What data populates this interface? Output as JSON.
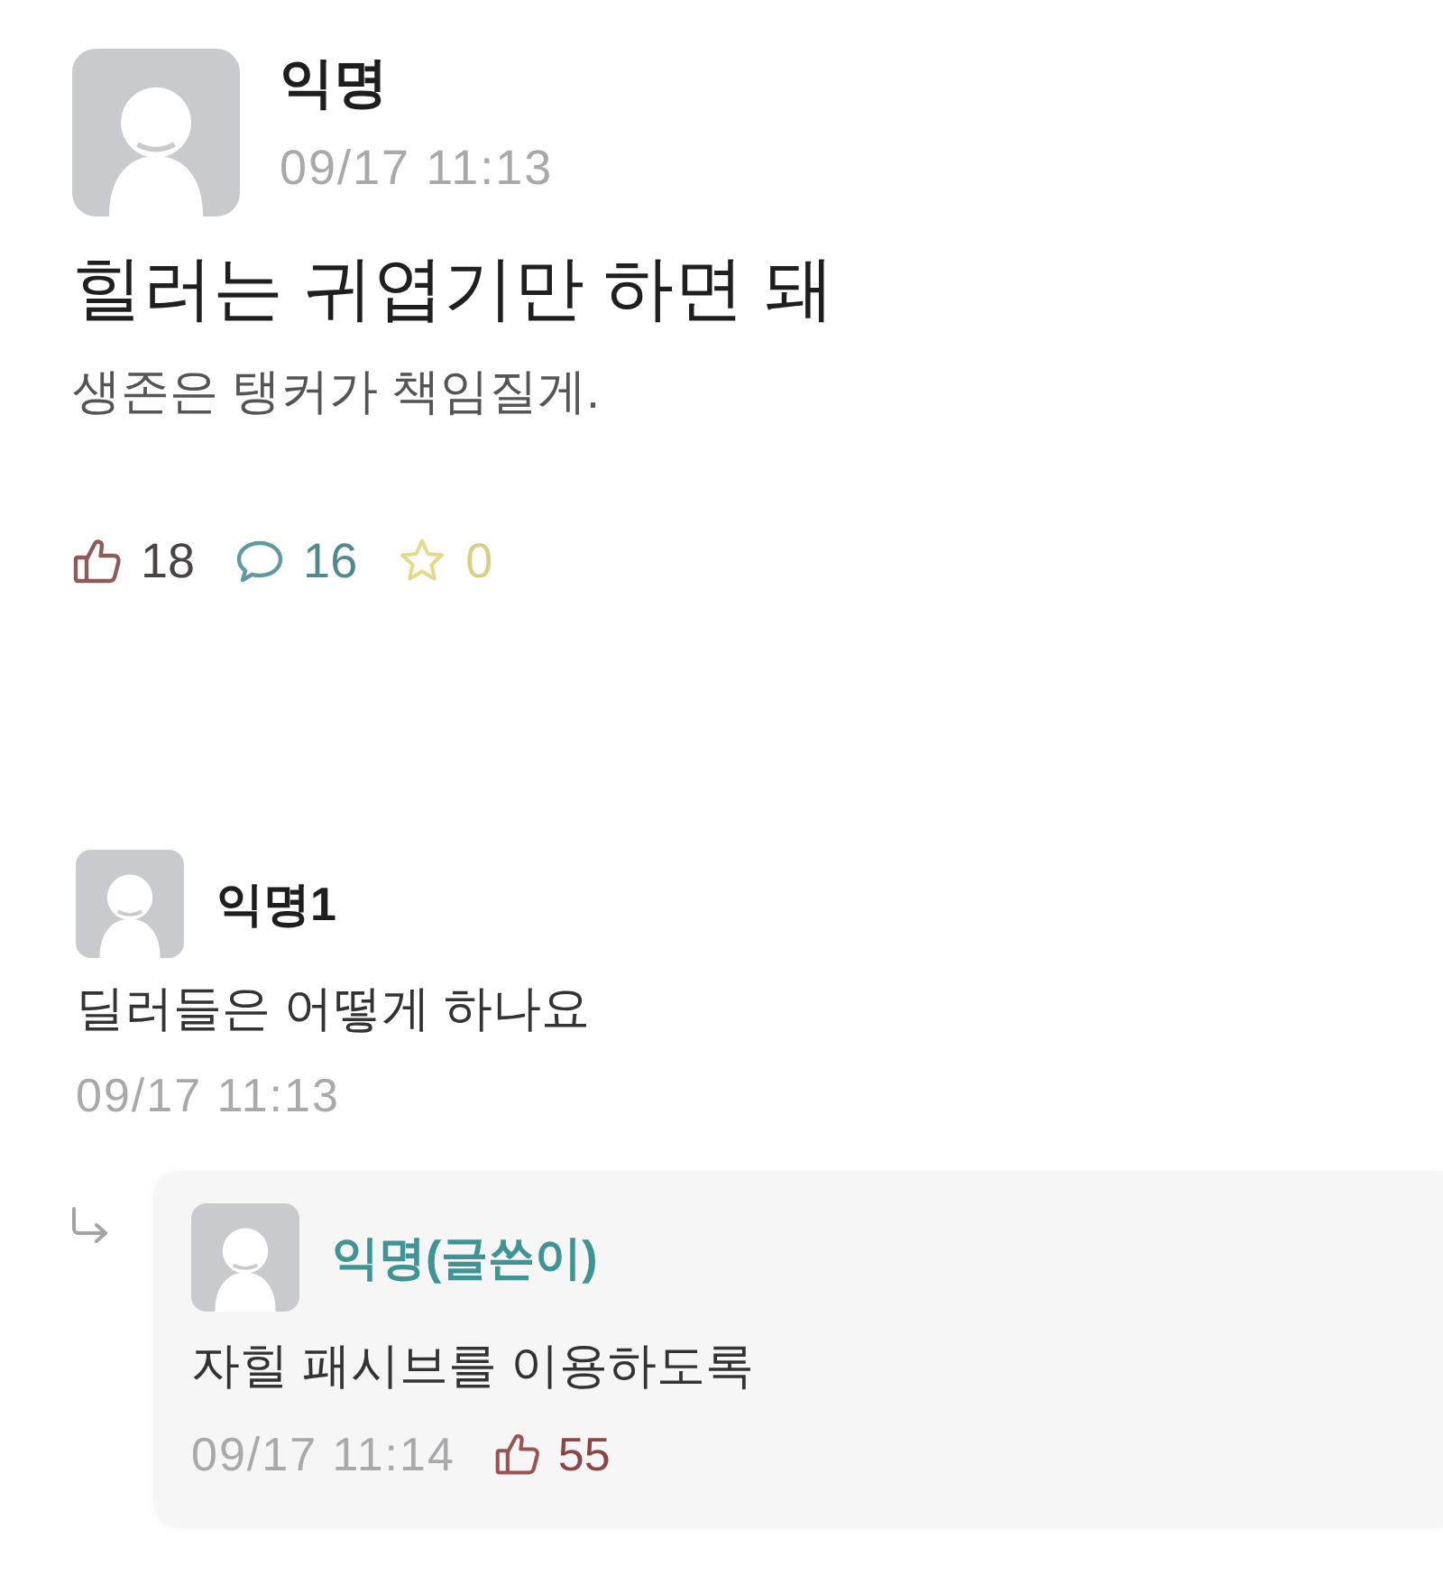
{
  "post": {
    "author": "익명",
    "timestamp": "09/17 11:13",
    "title": "힐러는 귀엽기만 하면 돼",
    "body": "생존은 탱커가 책임질게.",
    "stats": [
      {
        "kind": "likes",
        "count": "18"
      },
      {
        "kind": "comments",
        "count": "16"
      },
      {
        "kind": "scraps",
        "count": "0"
      }
    ]
  },
  "comments": [
    {
      "author": "익명1",
      "is_writer": false,
      "text": "딜러들은 어떻게 하나요",
      "timestamp": "09/17 11:13",
      "children": [
        {
          "author": "익명(글쓴이)",
          "is_writer": true,
          "text": "자힐 패시브를 이용하도록",
          "timestamp": "09/17 11:14",
          "likes": "55"
        }
      ]
    }
  ]
}
